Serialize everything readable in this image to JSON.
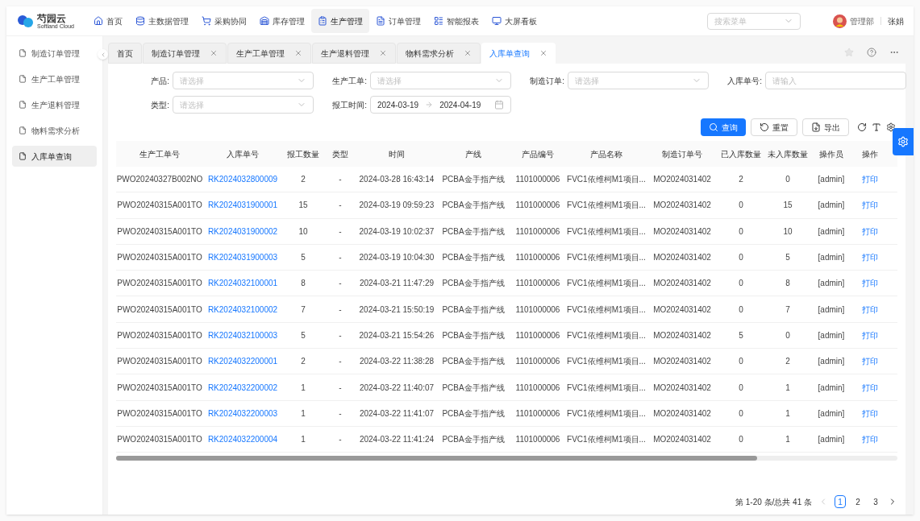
{
  "logo": {
    "name": "芍园云",
    "subtitle": "Softland Cloud"
  },
  "nav": [
    {
      "label": "首页",
      "selected": false
    },
    {
      "label": "主数据管理",
      "selected": false
    },
    {
      "label": "采购协同",
      "selected": false
    },
    {
      "label": "库存管理",
      "selected": false
    },
    {
      "label": "生产管理",
      "selected": true
    },
    {
      "label": "订单管理",
      "selected": false
    },
    {
      "label": "智能报表",
      "selected": false
    },
    {
      "label": "大屏看板",
      "selected": false
    }
  ],
  "menu_search": {
    "placeholder": "搜索菜单"
  },
  "user": {
    "department": "管理部",
    "name": "张娟"
  },
  "sidebar": {
    "items": [
      {
        "label": "制造订单管理",
        "selected": false
      },
      {
        "label": "生产工单管理",
        "selected": false
      },
      {
        "label": "生产退料管理",
        "selected": false
      },
      {
        "label": "物料需求分析",
        "selected": false
      },
      {
        "label": "入库单查询",
        "selected": true
      }
    ]
  },
  "tabs": [
    {
      "label": "首页",
      "closable": false,
      "selected": false
    },
    {
      "label": "制造订单管理",
      "closable": true,
      "selected": false
    },
    {
      "label": "生产工单管理",
      "closable": true,
      "selected": false
    },
    {
      "label": "生产退料管理",
      "closable": true,
      "selected": false
    },
    {
      "label": "物料需求分析",
      "closable": true,
      "selected": false
    },
    {
      "label": "入库单查询",
      "closable": true,
      "selected": true
    }
  ],
  "filters": [
    {
      "label": "产品:",
      "kind": "select",
      "placeholder": "请选择"
    },
    {
      "label": "生产工单:",
      "kind": "select",
      "placeholder": "请选择"
    },
    {
      "label": "制造订单:",
      "kind": "select",
      "placeholder": "请选择"
    },
    {
      "label": "入库单号:",
      "kind": "input",
      "placeholder": "请输入"
    },
    {
      "label": "类型:",
      "kind": "select",
      "placeholder": "请选择"
    },
    {
      "label": "报工时间:",
      "kind": "daterange",
      "start": "2024-03-19",
      "end": "2024-04-19"
    }
  ],
  "actions": [
    {
      "label": "查询",
      "kind": "primary"
    },
    {
      "label": "重置",
      "kind": "reset"
    },
    {
      "label": "导出",
      "kind": "export"
    }
  ],
  "table": {
    "columns": [
      {
        "label": "生产工单号",
        "kind": "text"
      },
      {
        "label": "入库单号",
        "kind": "link"
      },
      {
        "label": "报工数量",
        "kind": "text"
      },
      {
        "label": "类型",
        "kind": "text"
      },
      {
        "label": "时间",
        "kind": "text"
      },
      {
        "label": "产线",
        "kind": "text"
      },
      {
        "label": "产品编号",
        "kind": "text"
      },
      {
        "label": "产品名称",
        "kind": "text"
      },
      {
        "label": "制造订单号",
        "kind": "text"
      },
      {
        "label": "已入库数量",
        "kind": "text"
      },
      {
        "label": "未入库数量",
        "kind": "text"
      },
      {
        "label": "操作员",
        "kind": "text"
      },
      {
        "label": "操作",
        "kind": "link"
      }
    ],
    "rows": [
      [
        "PWO20240327B002NO",
        "RK2024032800009",
        "2",
        "-",
        "2024-03-28 16:43:14",
        "PCBA金手指产线",
        "1101000006",
        "FVC1依维柯M1项目...",
        "MO2024031402",
        "2",
        "0",
        "[admin]",
        "打印"
      ],
      [
        "PWO20240315A001TO",
        "RK2024031900001",
        "15",
        "-",
        "2024-03-19 09:59:23",
        "PCBA金手指产线",
        "1101000006",
        "FVC1依维柯M1项目...",
        "MO2024031402",
        "0",
        "15",
        "[admin]",
        "打印"
      ],
      [
        "PWO20240315A001TO",
        "RK2024031900002",
        "10",
        "-",
        "2024-03-19 10:02:37",
        "PCBA金手指产线",
        "1101000006",
        "FVC1依维柯M1项目...",
        "MO2024031402",
        "0",
        "10",
        "[admin]",
        "打印"
      ],
      [
        "PWO20240315A001TO",
        "RK2024031900003",
        "5",
        "-",
        "2024-03-19 10:04:30",
        "PCBA金手指产线",
        "1101000006",
        "FVC1依维柯M1项目...",
        "MO2024031402",
        "0",
        "5",
        "[admin]",
        "打印"
      ],
      [
        "PWO20240315A001TO",
        "RK2024032100001",
        "8",
        "-",
        "2024-03-21 11:47:29",
        "PCBA金手指产线",
        "1101000006",
        "FVC1依维柯M1项目...",
        "MO2024031402",
        "0",
        "8",
        "[admin]",
        "打印"
      ],
      [
        "PWO20240315A001TO",
        "RK2024032100002",
        "7",
        "-",
        "2024-03-21 15:50:19",
        "PCBA金手指产线",
        "1101000006",
        "FVC1依维柯M1项目...",
        "MO2024031402",
        "0",
        "7",
        "[admin]",
        "打印"
      ],
      [
        "PWO20240315A001TO",
        "RK2024032100003",
        "5",
        "-",
        "2024-03-21 15:54:26",
        "PCBA金手指产线",
        "1101000006",
        "FVC1依维柯M1项目...",
        "MO2024031402",
        "5",
        "0",
        "[admin]",
        "打印"
      ],
      [
        "PWO20240315A001TO",
        "RK2024032200001",
        "2",
        "-",
        "2024-03-22 11:38:28",
        "PCBA金手指产线",
        "1101000006",
        "FVC1依维柯M1项目...",
        "MO2024031402",
        "0",
        "2",
        "[admin]",
        "打印"
      ],
      [
        "PWO20240315A001TO",
        "RK2024032200002",
        "1",
        "-",
        "2024-03-22 11:40:07",
        "PCBA金手指产线",
        "1101000006",
        "FVC1依维柯M1项目...",
        "MO2024031402",
        "0",
        "1",
        "[admin]",
        "打印"
      ],
      [
        "PWO20240315A001TO",
        "RK2024032200003",
        "1",
        "-",
        "2024-03-22 11:41:07",
        "PCBA金手指产线",
        "1101000006",
        "FVC1依维柯M1项目...",
        "MO2024031402",
        "0",
        "1",
        "[admin]",
        "打印"
      ],
      [
        "PWO20240315A001TO",
        "RK2024032200004",
        "1",
        "-",
        "2024-03-22 11:41:24",
        "PCBA金手指产线",
        "1101000006",
        "FVC1依维柯M1项目...",
        "MO2024031402",
        "0",
        "1",
        "[admin]",
        "打印"
      ]
    ]
  },
  "pagination": {
    "summary": "第 1-20 条/总共 41 条",
    "pages": [
      {
        "label": "1",
        "selected": true
      },
      {
        "label": "2",
        "selected": false
      },
      {
        "label": "3",
        "selected": false
      }
    ]
  }
}
